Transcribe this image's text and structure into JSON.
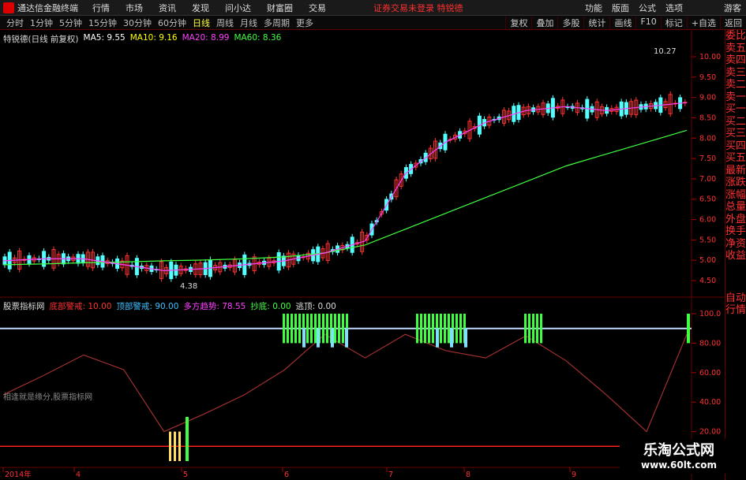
{
  "menubar": {
    "app_title": "通达信金融终端",
    "items": [
      "行情",
      "市场",
      "资讯",
      "发现",
      "问小达",
      "财富圈",
      "交易"
    ],
    "notice": "证券交易未登录 特锐德",
    "right": [
      "功能",
      "版面",
      "公式",
      "选项"
    ],
    "right2": "游客"
  },
  "tabbar": {
    "tabs": [
      "分时",
      "1分钟",
      "5分钟",
      "15分钟",
      "30分钟",
      "60分钟",
      "日线",
      "周线",
      "月线",
      "多周期",
      "更多"
    ],
    "active": "日线",
    "right": [
      "复权",
      "叠加",
      "多股",
      "统计",
      "画线",
      "F10",
      "标记",
      "+自选",
      "返回"
    ]
  },
  "main_legend": {
    "stock": "特锐德(日线 前复权)",
    "ma5": "MA5: 9.55",
    "ma10": "MA10: 9.16",
    "ma20": "MA20: 8.99",
    "ma60": "MA60: 8.36",
    "ma5_color": "#ffffff",
    "ma10_color": "#ffff00",
    "ma20_color": "#ff40ff",
    "ma60_color": "#40ff40"
  },
  "price_annotations": {
    "high": "10.27",
    "low": "4.38"
  },
  "price_axis": [
    "10.00",
    "9.50",
    "9.00",
    "8.50",
    "8.00",
    "7.50",
    "7.00",
    "6.50",
    "6.00",
    "5.50",
    "5.00",
    "4.50"
  ],
  "indicator_legend": {
    "name": "股票指标网",
    "bottom_warn": "底部警戒: 10.00",
    "top_warn": "顶部警戒: 90.00",
    "trend": "多方趋势: 78.55",
    "buy": "抄底: 0.00",
    "escape": "逃顶: 0.00"
  },
  "indicator_axis": [
    "100.0",
    "80.00",
    "60.00",
    "40.00",
    "20.00"
  ],
  "indicator_note": "相逢就是缘分,股票指标网",
  "date_axis": [
    "2014年",
    "4",
    "5",
    "6",
    "7",
    "8",
    "9"
  ],
  "sidebar": [
    "委比",
    "卖五",
    "卖四",
    "卖三",
    "卖二",
    "卖一",
    "买一",
    "买二",
    "买三",
    "买四",
    "买五",
    "最新",
    "涨跌",
    "涨幅",
    "总量",
    "外盘",
    "换手",
    "净资",
    "收益"
  ],
  "sidebar_bottom": [
    "自动",
    "行情"
  ],
  "watermark": {
    "title": "乐淘公式网",
    "url": "www.60lt.com"
  },
  "chart_data": {
    "type": "line",
    "ma60": [
      4.9,
      4.92,
      4.95,
      4.97,
      5.0,
      5.02,
      5.05,
      5.1,
      5.2,
      5.4,
      5.8,
      6.2,
      6.6,
      7.0,
      7.4,
      7.7,
      8.0,
      8.3
    ],
    "ma20": [
      5.0,
      5.05,
      5.05,
      4.9,
      4.75,
      4.8,
      4.9,
      5.0,
      5.2,
      5.5,
      7.2,
      8.0,
      8.5,
      8.8,
      8.9,
      8.8,
      8.9,
      9.0
    ],
    "indicator": [
      45,
      58,
      72,
      62,
      20,
      32,
      45,
      62,
      86,
      70,
      86,
      75,
      70,
      85,
      68,
      45,
      20,
      86
    ],
    "ylim": [
      4.3,
      10.4
    ]
  }
}
